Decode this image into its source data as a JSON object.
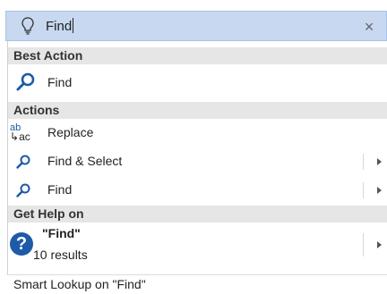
{
  "search": {
    "query": "Find",
    "close_glyph": "×"
  },
  "sections": {
    "best_action": "Best Action",
    "actions": "Actions",
    "get_help": "Get Help on"
  },
  "best_action": {
    "label": "Find",
    "icon": "magnifier-icon"
  },
  "actions": [
    {
      "label": "Replace",
      "icon": "replace-icon",
      "icon_text_top": "ab",
      "icon_text_bottom": "ac",
      "submenu": false
    },
    {
      "label": "Find & Select",
      "icon": "magnifier-icon",
      "submenu": true
    },
    {
      "label": "Find",
      "icon": "magnifier-icon",
      "submenu": true
    }
  ],
  "help": {
    "title": "\"Find\"",
    "count": "10 results",
    "icon": "help-icon",
    "icon_glyph": "?"
  },
  "footer": {
    "label": "Smart Lookup on \"Find\""
  },
  "colors": {
    "search_bg": "#c7d8f0",
    "accent": "#1e5aa8",
    "header_bg": "#e6e6e6"
  }
}
